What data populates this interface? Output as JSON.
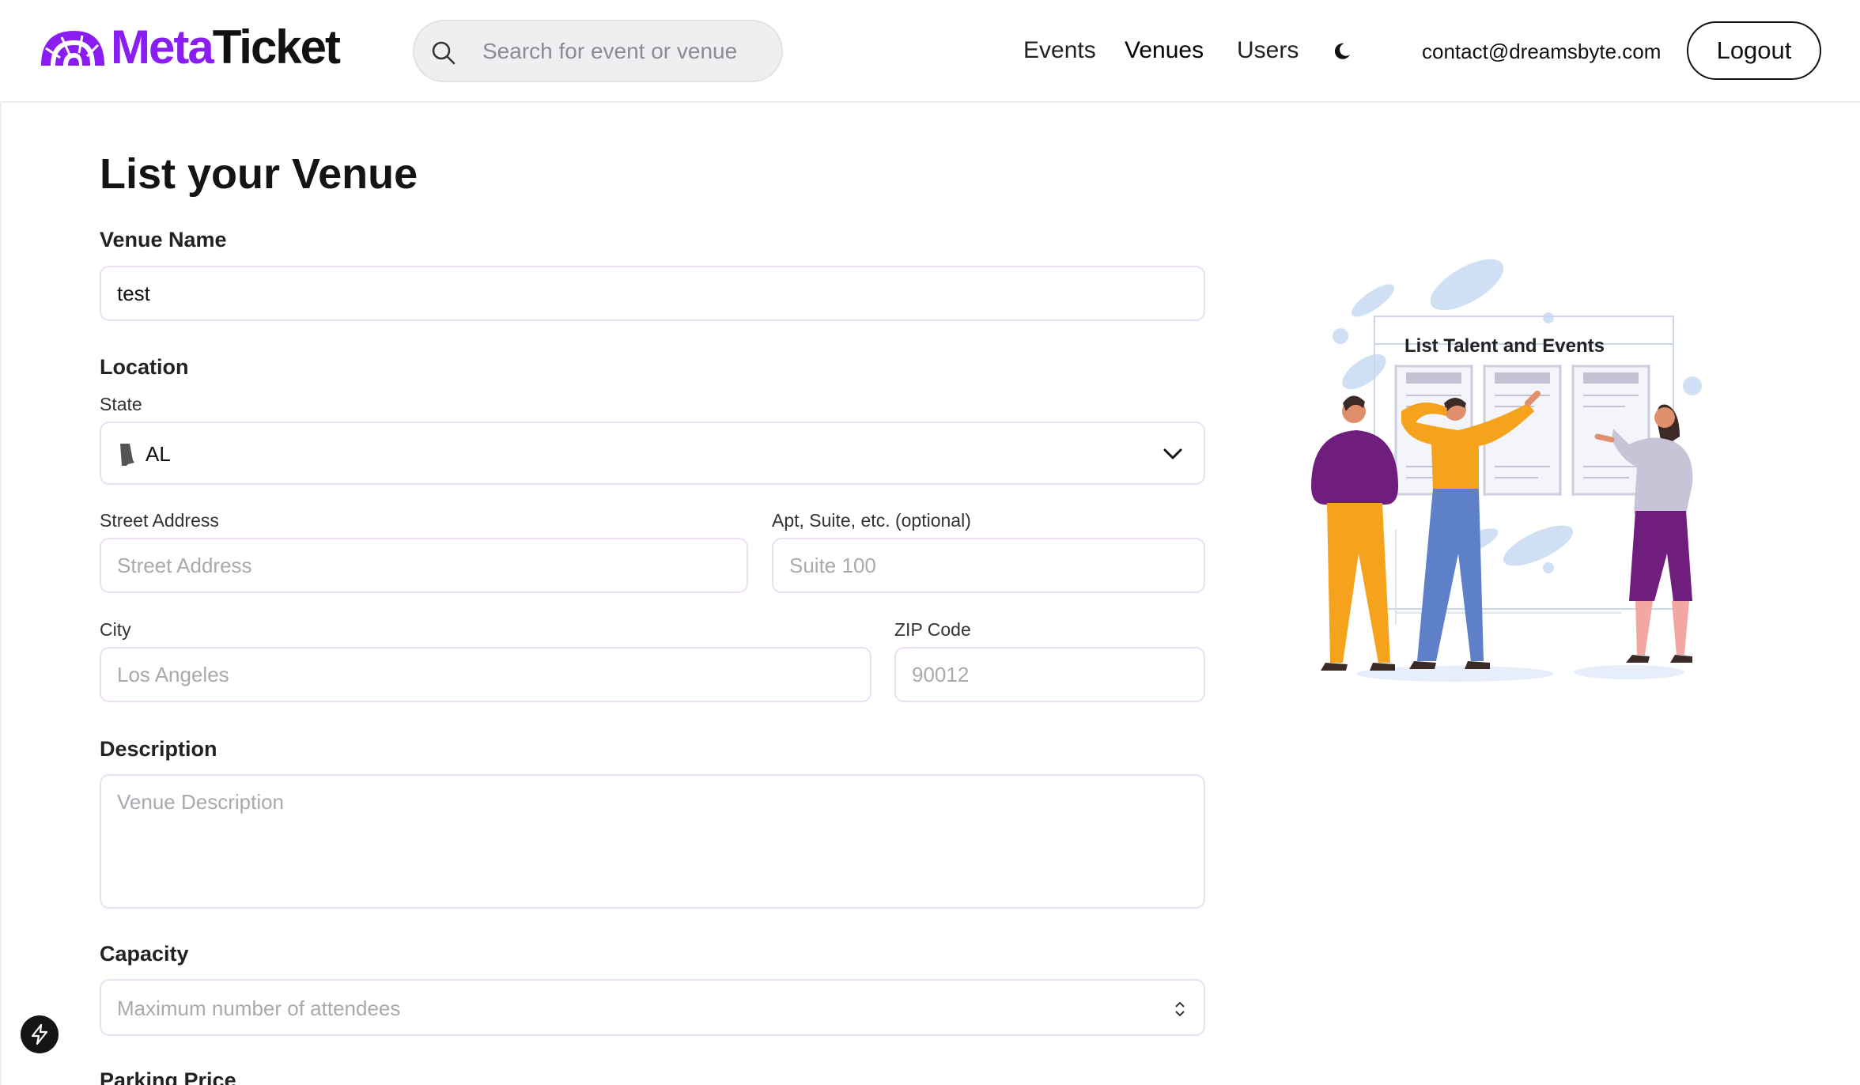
{
  "header": {
    "logo_meta": "Meta",
    "logo_ticket": "Ticket",
    "search_placeholder": "Search for event or venue",
    "nav": {
      "events": "Events",
      "venues": "Venues",
      "users": "Users"
    },
    "email": "contact@dreamsbyte.com",
    "logout": "Logout"
  },
  "form": {
    "title": "List your Venue",
    "venue_name": {
      "label": "Venue Name",
      "value": "test"
    },
    "location": {
      "label": "Location",
      "state": {
        "label": "State",
        "value": "AL"
      },
      "street": {
        "label": "Street Address",
        "placeholder": "Street Address"
      },
      "apt": {
        "label": "Apt, Suite, etc. (optional)",
        "placeholder": "Suite 100"
      },
      "city": {
        "label": "City",
        "placeholder": "Los Angeles"
      },
      "zip": {
        "label": "ZIP Code",
        "placeholder": "90012"
      }
    },
    "description": {
      "label": "Description",
      "placeholder": "Venue Description"
    },
    "capacity": {
      "label": "Capacity",
      "placeholder": "Maximum number of attendees"
    },
    "parking_price": {
      "label": "Parking Price"
    }
  },
  "illustration": {
    "title": "List Talent and Events"
  },
  "colors": {
    "brand": "#8a1ef2",
    "border": "#ecdff4"
  },
  "icons": [
    "logo-arc-icon",
    "search-icon",
    "moon-icon",
    "alabama-state-icon",
    "chevron-down-icon",
    "spinner-icon",
    "bolt-icon"
  ]
}
